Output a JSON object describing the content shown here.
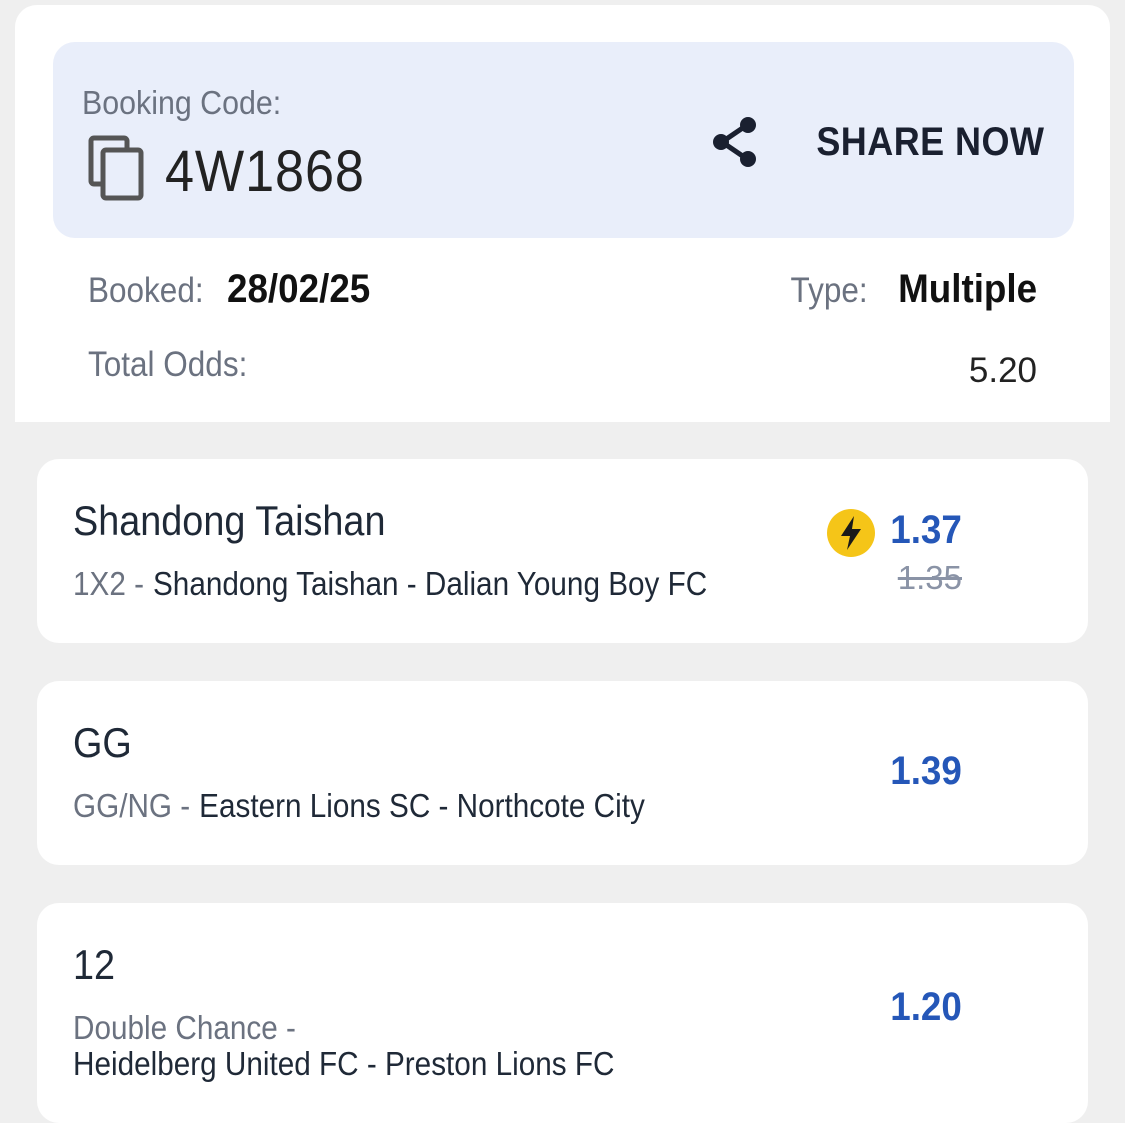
{
  "booking": {
    "code_label": "Booking Code:",
    "code": "4W1868",
    "share_label": "SHARE NOW",
    "booked_label": "Booked:",
    "booked_value": "28/02/25",
    "type_label": "Type:",
    "type_value": "Multiple",
    "total_odds_label": "Total Odds:",
    "total_odds_value": "5.20"
  },
  "selections": [
    {
      "title": "Shandong Taishan",
      "market": "1X2 -",
      "match": "Shandong Taishan - Dalian Young Boy FC",
      "odds": "1.37",
      "old_odds": "1.35",
      "boosted": true
    },
    {
      "title": "GG",
      "market": "GG/NG -",
      "match": "Eastern Lions SC - Northcote City",
      "odds": "1.39"
    },
    {
      "title": "12",
      "market": "Double Chance -",
      "match": "Heidelberg United FC - Preston Lions FC",
      "odds": "1.20"
    }
  ],
  "colors": {
    "accent": "#2557b8",
    "code_box": "#e9eefa",
    "boost": "#f5c518"
  },
  "icons": [
    "copy-icon",
    "share-icon",
    "lightning-boost-icon"
  ]
}
